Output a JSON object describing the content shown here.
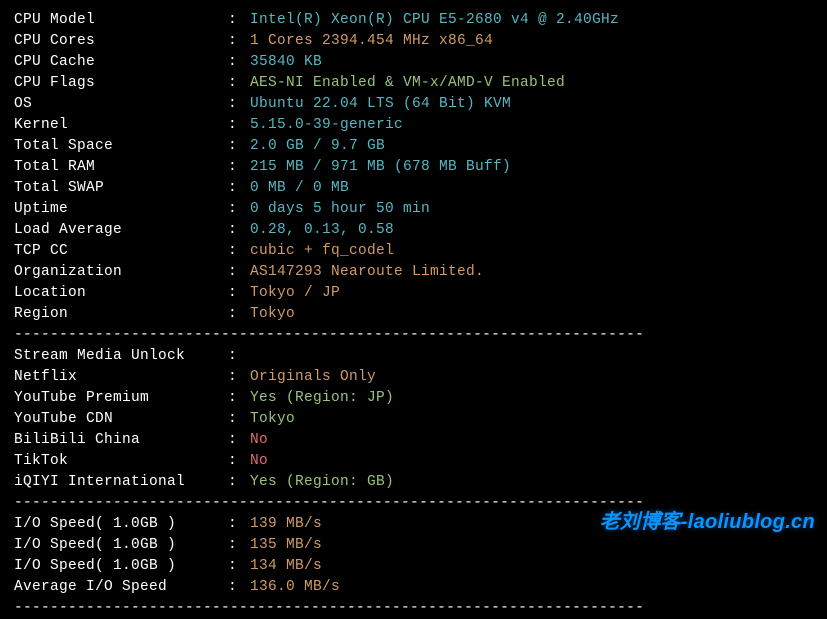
{
  "sysinfo": [
    {
      "label": "CPU Model",
      "value": "Intel(R) Xeon(R) CPU E5-2680 v4 @ 2.40GHz",
      "cls": "cyan"
    },
    {
      "label": "CPU Cores",
      "value": "1 Cores 2394.454 MHz x86_64",
      "cls": "yellow"
    },
    {
      "label": "CPU Cache",
      "value": "35840 KB",
      "cls": "cyan"
    },
    {
      "label": "CPU Flags",
      "value": "AES-NI Enabled & VM-x/AMD-V Enabled",
      "cls": "green"
    },
    {
      "label": "OS",
      "value": "Ubuntu 22.04 LTS (64 Bit) KVM",
      "cls": "cyan"
    },
    {
      "label": "Kernel",
      "value": "5.15.0-39-generic",
      "cls": "cyan"
    },
    {
      "label": "Total Space",
      "value": "2.0 GB / 9.7 GB",
      "cls": "cyan"
    },
    {
      "label": "Total RAM",
      "value": "215 MB / 971 MB (678 MB Buff)",
      "cls": "cyan"
    },
    {
      "label": "Total SWAP",
      "value": "0 MB / 0 MB",
      "cls": "cyan"
    },
    {
      "label": "Uptime",
      "value": "0 days 5 hour 50 min",
      "cls": "cyan"
    },
    {
      "label": "Load Average",
      "value": "0.28, 0.13, 0.58",
      "cls": "cyan"
    },
    {
      "label": "TCP CC",
      "value": "cubic + fq_codel",
      "cls": "yellow"
    },
    {
      "label": "Organization",
      "value": "AS147293 Nearoute Limited.",
      "cls": "yellow"
    },
    {
      "label": "Location",
      "value": "Tokyo / JP",
      "cls": "yellow"
    },
    {
      "label": "Region",
      "value": "Tokyo",
      "cls": "yellow"
    }
  ],
  "media_header": "Stream Media Unlock",
  "media": [
    {
      "label": "Netflix",
      "value": "Originals Only",
      "cls": "yellow"
    },
    {
      "label": "YouTube Premium",
      "value": "Yes (Region: JP)",
      "cls": "green"
    },
    {
      "label": "YouTube CDN",
      "value": "Tokyo",
      "cls": "green"
    },
    {
      "label": "BiliBili China",
      "value": "No",
      "cls": "red"
    },
    {
      "label": "TikTok",
      "value": "No",
      "cls": "red"
    },
    {
      "label": "iQIYI International",
      "value": "Yes (Region: GB)",
      "cls": "green"
    }
  ],
  "io": [
    {
      "label": "I/O Speed( 1.0GB )",
      "value": "139 MB/s",
      "cls": "yellow"
    },
    {
      "label": "I/O Speed( 1.0GB )",
      "value": "135 MB/s",
      "cls": "yellow"
    },
    {
      "label": "I/O Speed( 1.0GB )",
      "value": "134 MB/s",
      "cls": "yellow"
    },
    {
      "label": "Average I/O Speed",
      "value": "136.0 MB/s",
      "cls": "yellow"
    }
  ],
  "divider": "----------------------------------------------------------------------",
  "watermark": "老刘博客-laoliublog.cn"
}
